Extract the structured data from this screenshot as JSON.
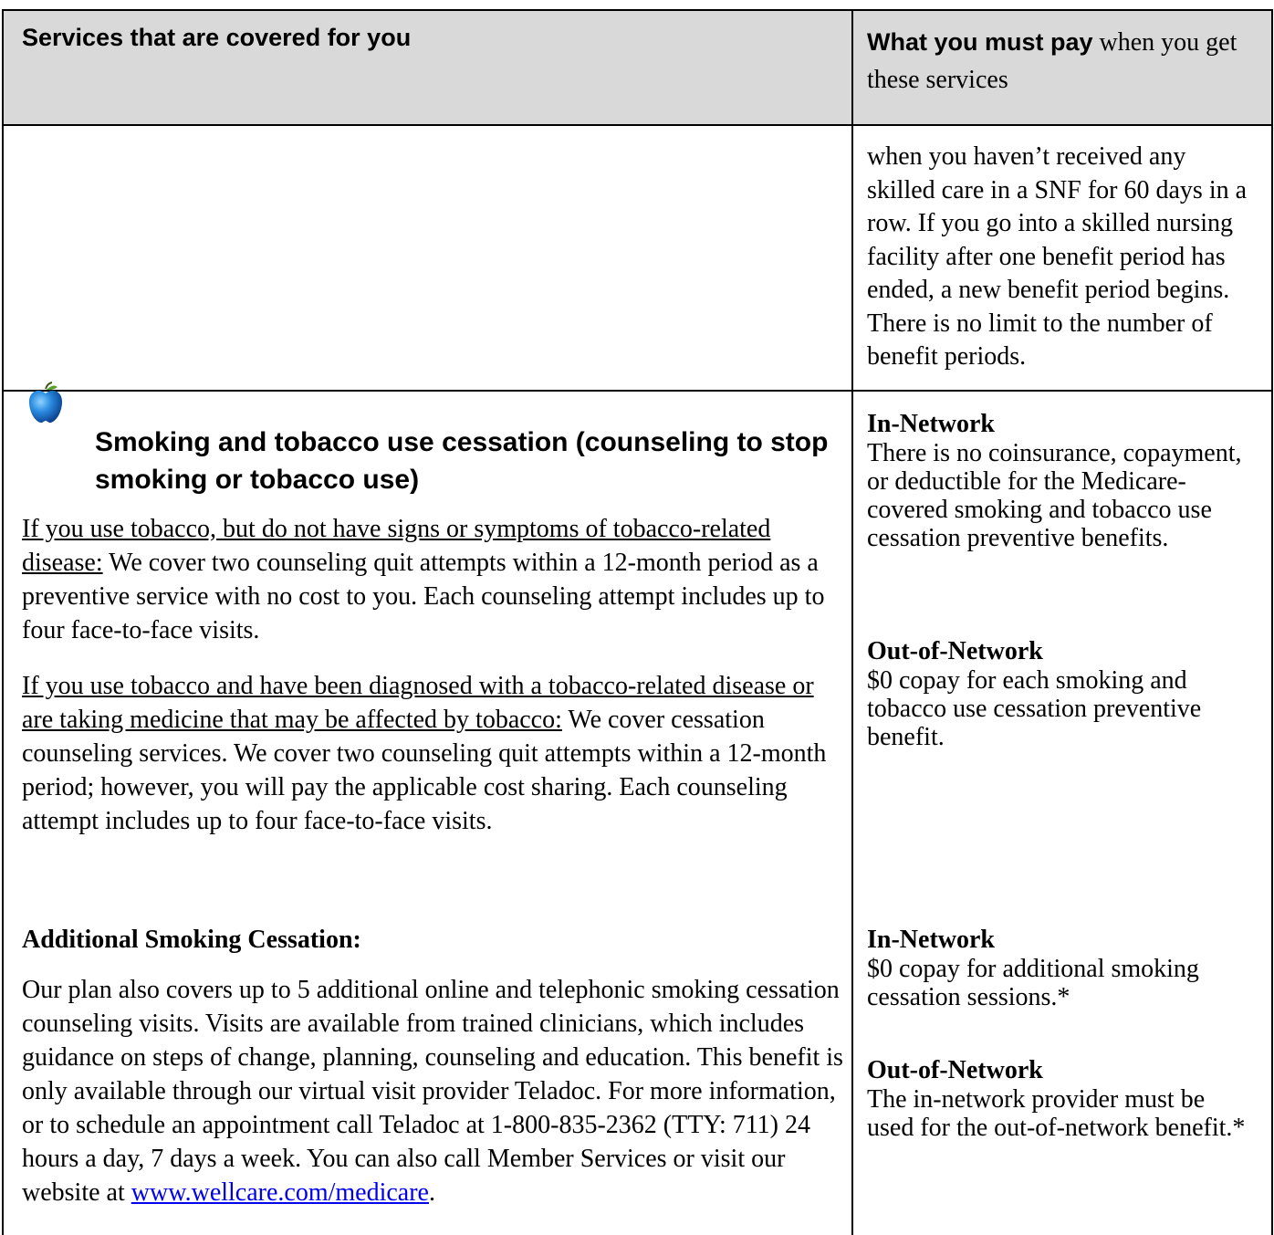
{
  "header": {
    "left": "Services that are covered for you",
    "right_bold": "What you must pay",
    "right_rest": " when you get these services"
  },
  "continuation": {
    "text": "when you haven’t received any skilled care in a SNF for 60 days in a row. If you go into a skilled nursing facility after one benefit period has ended, a new benefit period begins. There is no limit to the number of benefit periods."
  },
  "smoking": {
    "icon": "apple-icon",
    "title": "Smoking and tobacco use cessation (counseling to stop smoking or tobacco use)",
    "para1_underlined": "If you use tobacco, but do not have signs or symptoms of tobacco-related disease:",
    "para1_rest": " We cover two counseling quit attempts within a 12-month period as a preventive service with no cost to you. Each counseling attempt includes up to four face-to-face visits.",
    "para2_underlined": "If you use tobacco and have been diagnosed with a tobacco-related disease or are taking medicine that may be affected by tobacco:",
    "para2_rest": " We cover cessation counseling services. We cover two counseling quit attempts within a 12-month period; however, you will pay the applicable cost sharing. Each counseling attempt includes up to four face-to-face visits.",
    "in_network_label": "In-Network",
    "in_network_text": "There is no coinsurance, copayment, or deductible for the Medicare-covered smoking and tobacco use cessation preventive benefits.",
    "out_network_label": "Out-of-Network",
    "out_network_text": "$0 copay for each smoking and tobacco use cessation preventive benefit."
  },
  "additional": {
    "heading": "Additional Smoking Cessation:",
    "body_text": "Our plan also covers up to 5 additional online and telephonic smoking cessation counseling visits. Visits are available from trained clinicians, which includes guidance on steps of change, planning, counseling and education. This benefit is only available through our virtual visit provider Teladoc. For more information, or to schedule an appointment call Teladoc at 1-800-835-2362 (TTY: 711) 24 hours a day, 7 days a week. You can also call Member Services or visit our website at ",
    "link_text": "www.wellcare.com/medicare",
    "link_after": ".",
    "in_network_label": "In-Network",
    "in_network_text": "$0 copay for additional smoking cessation sessions.*",
    "out_network_label": "Out-of-Network",
    "out_network_text": "The in-network provider must be used for the out-of-network benefit.*"
  }
}
